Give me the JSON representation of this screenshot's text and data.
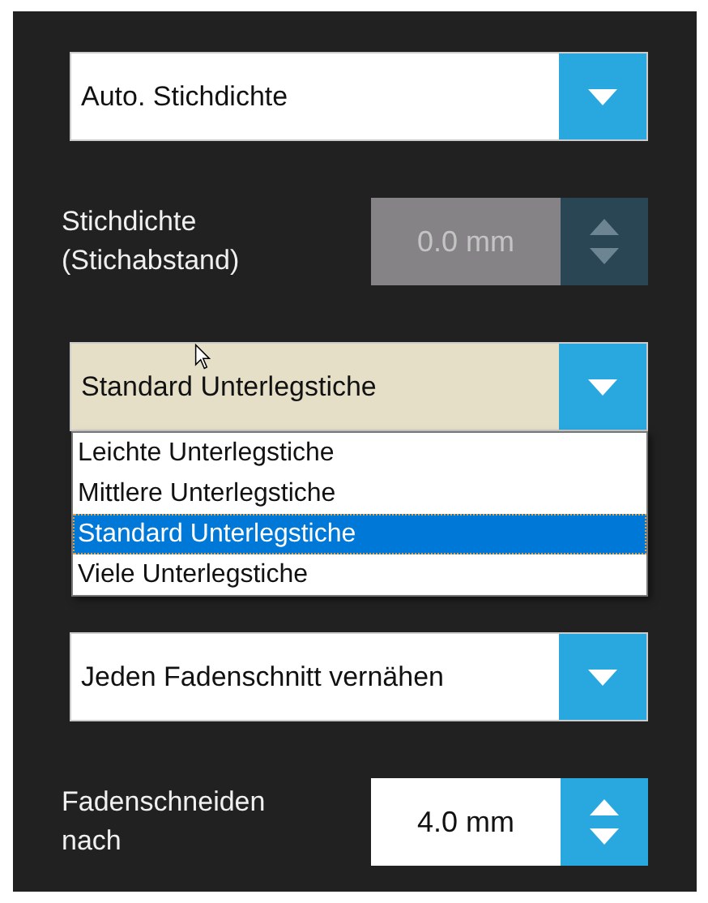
{
  "density_mode": {
    "value": "Auto. Stichdichte"
  },
  "stitch_density": {
    "label": "Stichdichte\n(Stichabstand)",
    "value": "0.0 mm",
    "disabled": true
  },
  "underlay": {
    "value": "Standard Unterlegstiche",
    "open": true,
    "options": [
      {
        "label": "Leichte Unterlegstiche",
        "selected": false
      },
      {
        "label": "Mittlere Unterlegstiche",
        "selected": false
      },
      {
        "label": "Standard Unterlegstiche",
        "selected": true
      },
      {
        "label": "Viele Unterlegstiche",
        "selected": false
      }
    ]
  },
  "tie_off": {
    "value": "Jeden Fadenschnitt vernähen"
  },
  "trim_after": {
    "label": "Fadenschneiden\nnach",
    "value": "4.0 mm",
    "disabled": false
  }
}
